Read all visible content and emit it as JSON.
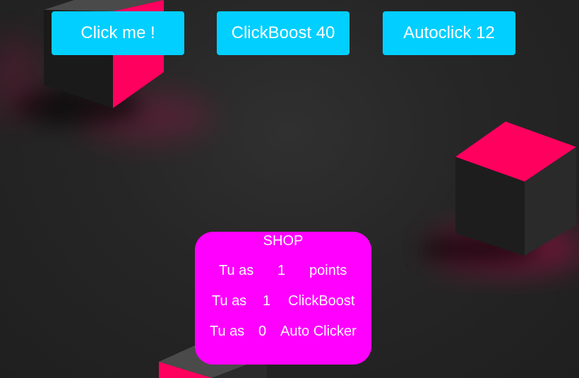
{
  "buttons": {
    "click_label": "Click me !",
    "boost_label": "ClickBoost 40",
    "autoclick_label": "Autoclick 12"
  },
  "shop": {
    "title": "SHOP",
    "rows": [
      {
        "prefix": "Tu as",
        "value": "1",
        "label": "points"
      },
      {
        "prefix": "Tu as",
        "value": "1",
        "label": "ClickBoost"
      },
      {
        "prefix": "Tu as",
        "value": "0",
        "label": "Auto Clicker"
      }
    ]
  },
  "colors": {
    "button_bg": "#00cfff",
    "shop_bg": "#ff00ff",
    "cube_accent": "#ff005e",
    "background": "#262626"
  }
}
